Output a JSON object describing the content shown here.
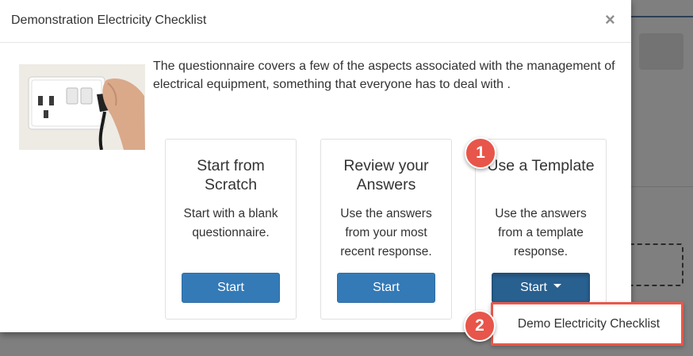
{
  "modal": {
    "title": "Demonstration Electricity Checklist",
    "close_label": "×",
    "intro": "The questionnaire covers a few of the aspects associated with the management of electrical equipment, something that everyone has to deal with ."
  },
  "cards": [
    {
      "title": "Start from Scratch",
      "description": "Start with a blank questionnaire.",
      "button_label": "Start"
    },
    {
      "title": "Review your Answers",
      "description": "Use the answers from your most recent response.",
      "button_label": "Start"
    },
    {
      "title": "Use a Template",
      "description": "Use the answers from a template response.",
      "button_label": "Start"
    }
  ],
  "dropdown": {
    "items": [
      {
        "label": "Demo Electricity Checklist"
      }
    ]
  },
  "annotations": {
    "step_1": "1",
    "step_2": "2"
  },
  "colors": {
    "primary_button": "#337ab7",
    "annotation_red": "#e8554a"
  },
  "icons": {
    "close": "close-icon",
    "caret": "chevron-down-icon",
    "photo": "plug-socket-photo"
  }
}
